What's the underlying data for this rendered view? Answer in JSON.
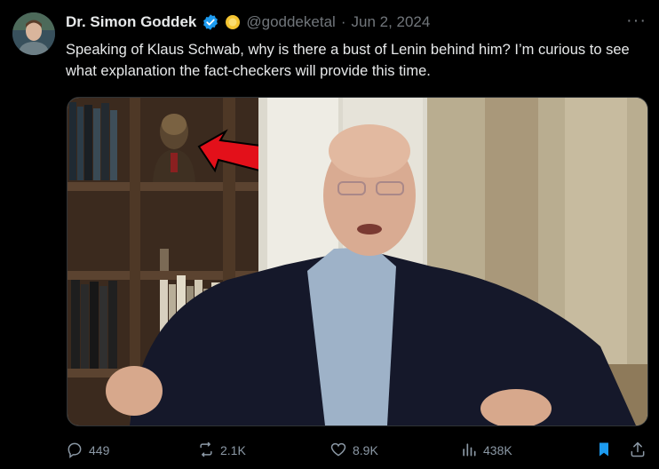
{
  "author": {
    "name": "Dr. Simon Goddek",
    "handle": "@goddeketal",
    "separator": "·",
    "date": "Jun 2, 2024"
  },
  "tweet": {
    "text": "Speaking of Klaus Schwab, why is there a bust of Lenin behind him? I’m curious to see what explanation the fact-checkers will provide this time."
  },
  "actions": {
    "replies": "449",
    "reposts": "2.1K",
    "likes": "8.9K",
    "views": "438K"
  },
  "icons": {
    "verified": "verified-badge-icon",
    "gold": "gold-badge-icon",
    "more": "more-dots-icon",
    "reply": "reply-icon",
    "repost": "repost-icon",
    "like": "heart-icon",
    "views": "views-chart-icon",
    "bookmark": "bookmark-icon",
    "share": "share-icon"
  },
  "colors": {
    "background": "#000000",
    "text": "#e7e9ea",
    "secondary": "#71767b",
    "verified_blue": "#1d9bf0",
    "bookmark_blue": "#1d9bf0",
    "arrow_red": "#e3101a"
  }
}
